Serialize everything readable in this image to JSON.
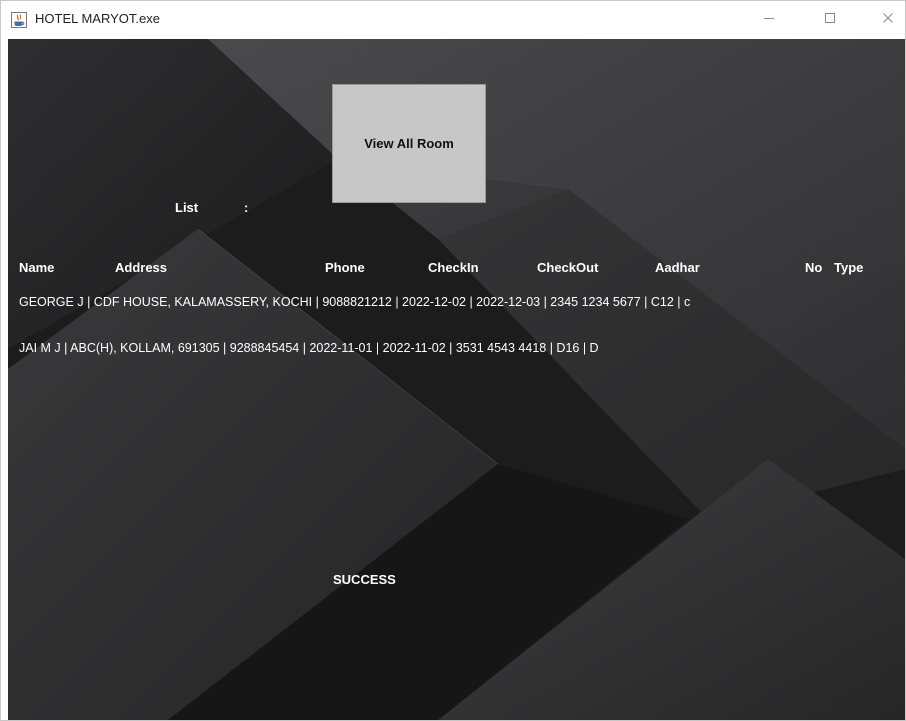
{
  "window": {
    "title": "HOTEL MARYOT.exe"
  },
  "icons": {
    "app": "java-icon",
    "minimize": "minimize-icon",
    "maximize": "maximize-icon",
    "close": "close-icon"
  },
  "main": {
    "view_button_label": "View All Room",
    "list_label": "List",
    "list_colon": ":",
    "columns": [
      "Name",
      "Address",
      "Phone",
      "CheckIn",
      "CheckOut",
      "Aadhar",
      "No",
      "Type"
    ],
    "rows": [
      "GEORGE J  |  CDF HOUSE, KALAMASSERY, KOCHI  |   9088821212  |   2022-12-02  |   2022-12-03  |   2345 1234 5677   |  C12  |  c",
      "JAI M J  |  ABC(H), KOLLAM, 691305  |   9288845454  |   2022-11-01  |   2022-11-02  |   3531 4543 4418   |  D16  |  D"
    ],
    "status": "SUCCESS"
  }
}
